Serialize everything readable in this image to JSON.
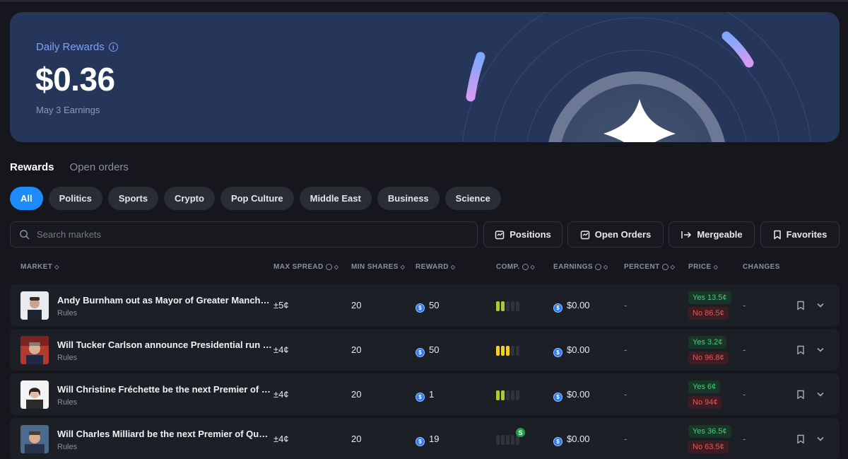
{
  "banner": {
    "label": "Daily Rewards",
    "amount": "$0.36",
    "subtitle": "May 3 Earnings"
  },
  "tabs": [
    {
      "label": "Rewards",
      "active": true
    },
    {
      "label": "Open orders",
      "active": false
    }
  ],
  "chips": [
    {
      "label": "All",
      "active": true
    },
    {
      "label": "Politics"
    },
    {
      "label": "Sports"
    },
    {
      "label": "Crypto"
    },
    {
      "label": "Pop Culture"
    },
    {
      "label": "Middle East"
    },
    {
      "label": "Business"
    },
    {
      "label": "Science"
    }
  ],
  "search": {
    "placeholder": "Search markets"
  },
  "toolbar": {
    "positions": "Positions",
    "open_orders": "Open Orders",
    "mergeable": "Mergeable",
    "favorites": "Favorites"
  },
  "columns": {
    "market": "MARKET",
    "max_spread": "MAX SPREAD",
    "min_shares": "MIN SHARES",
    "reward": "REWARD",
    "comp": "COMP.",
    "earnings": "EARNINGS",
    "percent": "PERCENT",
    "price": "PRICE",
    "changes": "CHANGES"
  },
  "rows": [
    {
      "title": "Andy Burnham out as Mayor of Greater Manchester...",
      "rules": "Rules",
      "spread": "±5¢",
      "min_shares": "20",
      "reward": "50",
      "competition_level": 2,
      "competition_color": "green",
      "earnings": "$0.00",
      "percent": "-",
      "yes": "Yes 13.5¢",
      "no": "No 86.5¢",
      "changes": "-"
    },
    {
      "title": "Will Tucker Carlson announce Presidential run by ...",
      "rules": "Rules",
      "spread": "±4¢",
      "min_shares": "20",
      "reward": "50",
      "competition_level": 3,
      "competition_color": "yellow",
      "earnings": "$0.00",
      "percent": "-",
      "yes": "Yes 3.2¢",
      "no": "No 96.8¢",
      "changes": "-"
    },
    {
      "title": "Will Christine Fréchette be the next Premier of Qu...",
      "rules": "Rules",
      "spread": "±4¢",
      "min_shares": "20",
      "reward": "1",
      "competition_level": 2,
      "competition_color": "green",
      "earnings": "$0.00",
      "percent": "-",
      "yes": "Yes 6¢",
      "no": "No 94¢",
      "changes": "-"
    },
    {
      "title": "Will Charles Milliard be the next Premier of Quebe...",
      "rules": "Rules",
      "spread": "±4¢",
      "min_shares": "20",
      "reward": "19",
      "competition_level": 0,
      "competition_color": "none",
      "competition_badge": "S",
      "earnings": "$0.00",
      "percent": "-",
      "yes": "Yes 36.5¢",
      "no": "No 63.5¢",
      "changes": "-"
    }
  ],
  "icons": {
    "info": "info-icon",
    "search": "search-icon",
    "coin": "usdc-coin-icon",
    "bookmark": "bookmark-icon",
    "chevron": "chevron-down-icon",
    "sort": "sort-icon"
  },
  "colors": {
    "accent": "#1d8cf8",
    "banner": "#26365a",
    "yes": "#3fd07a",
    "no": "#f0545c"
  }
}
